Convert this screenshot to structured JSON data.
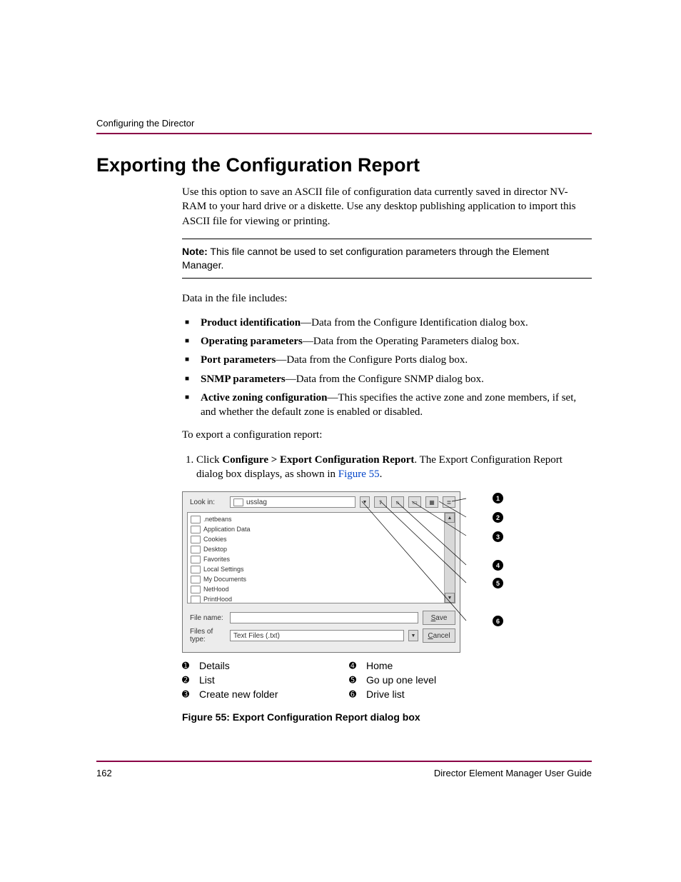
{
  "header": {
    "running": "Configuring the Director"
  },
  "title": "Exporting the Configuration Report",
  "intro": "Use this option to save an ASCII file of configuration data currently saved in director NV-RAM to your hard drive or a diskette. Use any desktop publishing application to import this ASCII file for viewing or printing.",
  "note": {
    "label": "Note:",
    "text": "This file cannot be used to set configuration parameters through the Element Manager."
  },
  "includes_lead": "Data in the file includes:",
  "bullets": [
    {
      "b": "Product identification",
      "rest": "—Data from the Configure Identification dialog box."
    },
    {
      "b": "Operating parameters",
      "rest": "—Data from the Operating Parameters dialog box."
    },
    {
      "b": "Port parameters",
      "rest": "—Data from the Configure Ports dialog box."
    },
    {
      "b": "SNMP parameters",
      "rest": "—Data from the Configure SNMP dialog box."
    },
    {
      "b": "Active zoning configuration",
      "rest": "—This specifies the active zone and zone members, if set, and whether the default zone is enabled or disabled."
    }
  ],
  "export_lead": "To export a configuration report:",
  "step1_pre": "Click ",
  "step1_bold": "Configure > Export Configuration Report",
  "step1_mid": ". The Export Configuration Report dialog box displays, as shown in ",
  "step1_link": "Figure 55",
  "step1_end": ".",
  "dialog": {
    "look_in_label": "Look in:",
    "look_in_value": "usslag",
    "entries": [
      ".netbeans",
      "Application Data",
      "Cookies",
      "Desktop",
      "Favorites",
      "Local Settings",
      "My Documents",
      "NetHood",
      "PrintHood"
    ],
    "file_name_label": "File name:",
    "file_name_value": "",
    "type_label": "Files of type:",
    "type_value": "Text Files (.txt)",
    "save": "Save",
    "cancel": "Cancel"
  },
  "callouts": [
    "1",
    "2",
    "3",
    "4",
    "5",
    "6"
  ],
  "legend": [
    {
      "n": "➊",
      "t": "Details"
    },
    {
      "n": "➋",
      "t": "List"
    },
    {
      "n": "➌",
      "t": "Create new folder"
    },
    {
      "n": "➍",
      "t": "Home"
    },
    {
      "n": "➎",
      "t": "Go up one level"
    },
    {
      "n": "➏",
      "t": "Drive list"
    }
  ],
  "figure_caption": "Figure 55:  Export Configuration Report dialog box",
  "footer": {
    "page": "162",
    "book": "Director Element Manager User Guide"
  }
}
